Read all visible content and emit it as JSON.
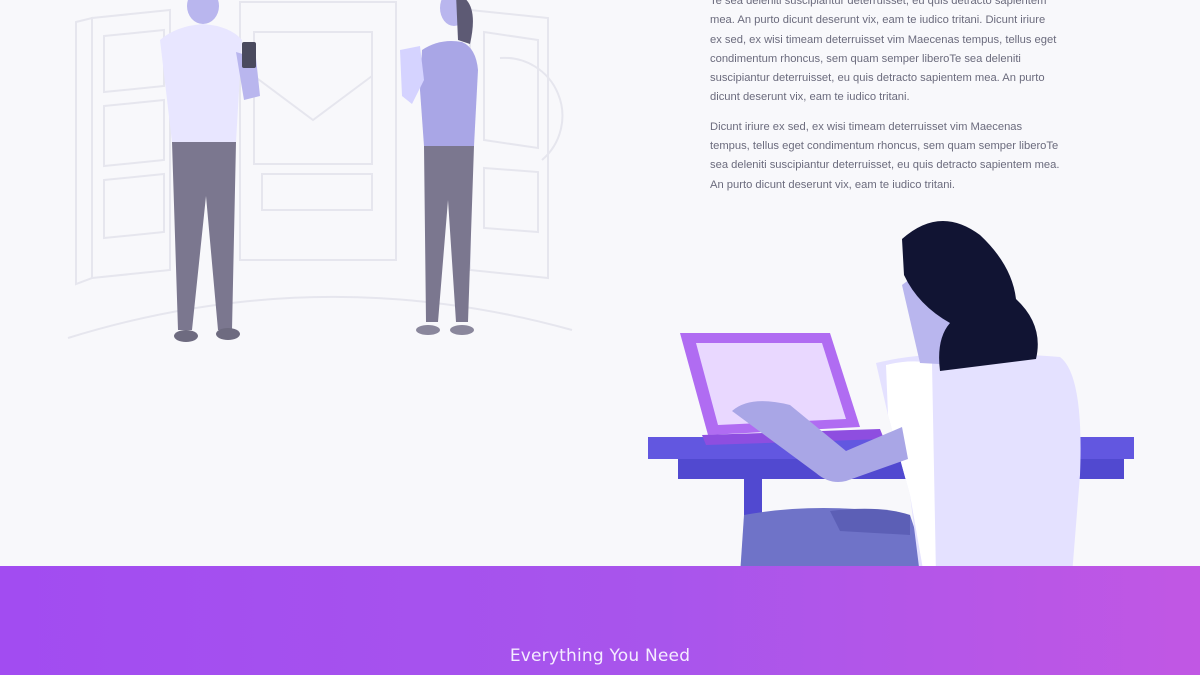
{
  "body_text": {
    "paragraph_1": "Te sea deleniti suscipiantur deterruisset, eu quis detracto sapientem mea. An purto dicunt deserunt vix, eam te iudico tritani. Dicunt iriure ex sed, ex wisi timeam deterruisset vim Maecenas tempus, tellus eget condimentum rhoncus, sem quam semper liberoTe sea deleniti suscipiantur deterruisset, eu quis detracto sapientem mea. An purto dicunt deserunt vix, eam te iudico tritani.",
    "paragraph_2": "Dicunt iriure ex sed, ex wisi timeam deterruisset vim Maecenas tempus, tellus eget condimentum rhoncus, sem quam semper liberoTe sea deleniti suscipiantur deterruisset, eu quis detracto sapientem mea. An purto dicunt deserunt vix, eam te iudico tritani."
  },
  "band": {
    "title": "Everything You Need"
  },
  "colors": {
    "background": "#f8f8fb",
    "accent_purple": "#a855ec",
    "desk": "#6257e0",
    "laptop": "#b06cf2",
    "hair": "#111433",
    "figure_light": "#e4e1ff",
    "figure_mid": "#a9a6e6",
    "figure_dark": "#7a7792"
  }
}
